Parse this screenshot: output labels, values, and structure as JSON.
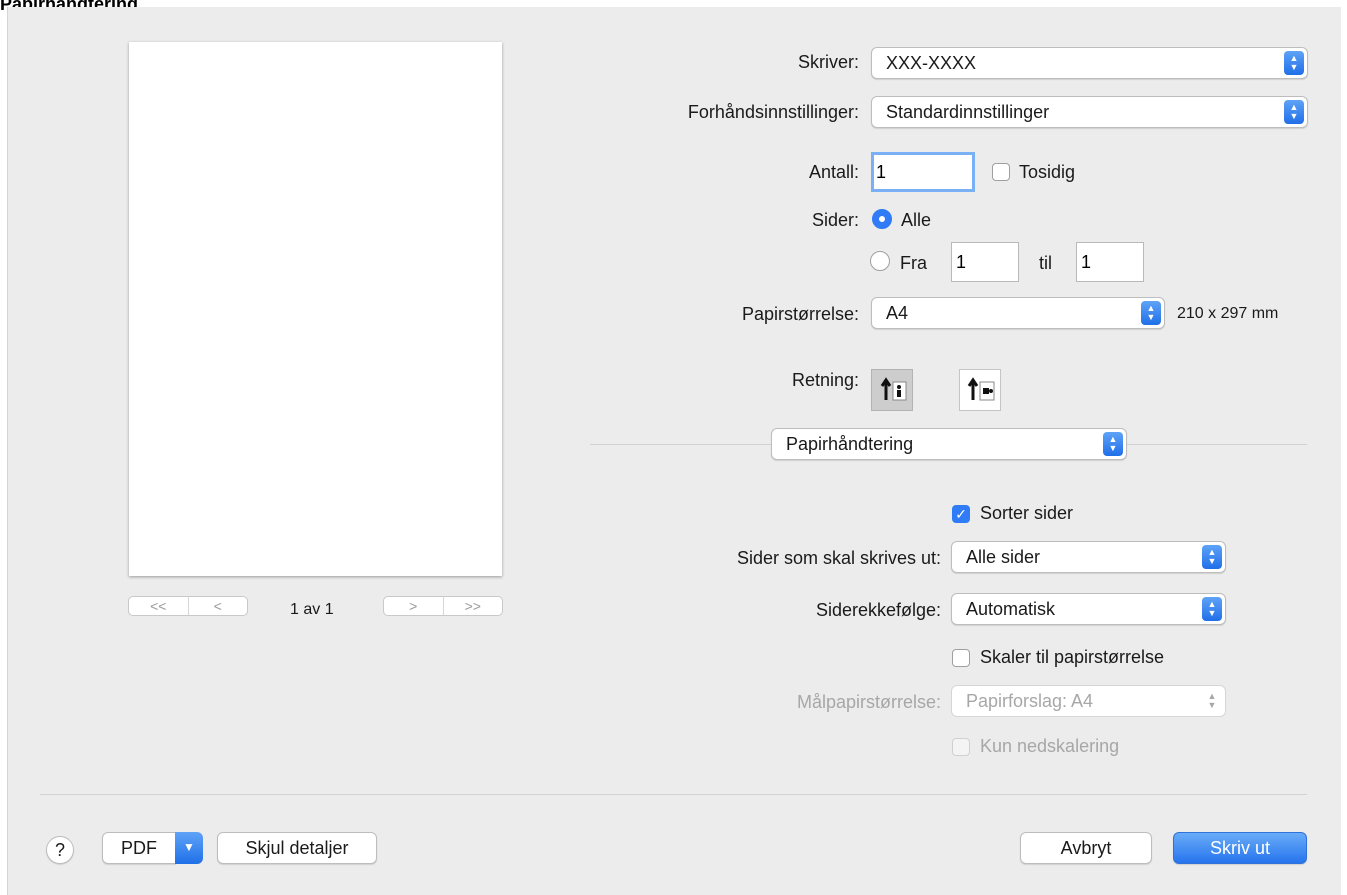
{
  "window": {
    "title": "Papirhåndtering"
  },
  "preview": {
    "first_label": "<<",
    "prev_label": "<",
    "next_label": ">",
    "last_label": ">>",
    "page_count": "1 av 1"
  },
  "printer": {
    "label": "Skriver:",
    "value": "XXX-XXXX"
  },
  "presets": {
    "label": "Forhåndsinnstillinger:",
    "value": "Standardinnstillinger"
  },
  "copies": {
    "label": "Antall:",
    "value": "1",
    "duplex_label": "Tosidig",
    "duplex_checked": false
  },
  "pages": {
    "label": "Sider:",
    "all_label": "Alle",
    "from_label": "Fra",
    "from_value": "1",
    "to_label": "til",
    "to_value": "1",
    "selected": "all"
  },
  "paper_size": {
    "label": "Papirstørrelse:",
    "value": "A4",
    "dimensions": "210 x 297 mm"
  },
  "orientation": {
    "label": "Retning:",
    "selected": "portrait"
  },
  "section": {
    "value": "Papirhåndtering"
  },
  "collate": {
    "label": "Sorter sider",
    "checked": true
  },
  "pages_to_print": {
    "label": "Sider som skal skrives ut:",
    "value": "Alle sider"
  },
  "page_order": {
    "label": "Siderekkefølge:",
    "value": "Automatisk"
  },
  "scale_to_fit": {
    "label": "Skaler til papirstørrelse",
    "checked": false
  },
  "dest_paper_size": {
    "label": "Målpapirstørrelse:",
    "value": "Papirforslag: A4",
    "disabled": true
  },
  "scale_down_only": {
    "label": "Kun nedskalering",
    "disabled": true
  },
  "footer": {
    "help_label": "?",
    "pdf_label": "PDF",
    "hide_details_label": "Skjul detaljer",
    "cancel_label": "Avbryt",
    "print_label": "Skriv ut"
  },
  "colors": {
    "accent": "#2f7cf6",
    "background": "#ececec"
  }
}
